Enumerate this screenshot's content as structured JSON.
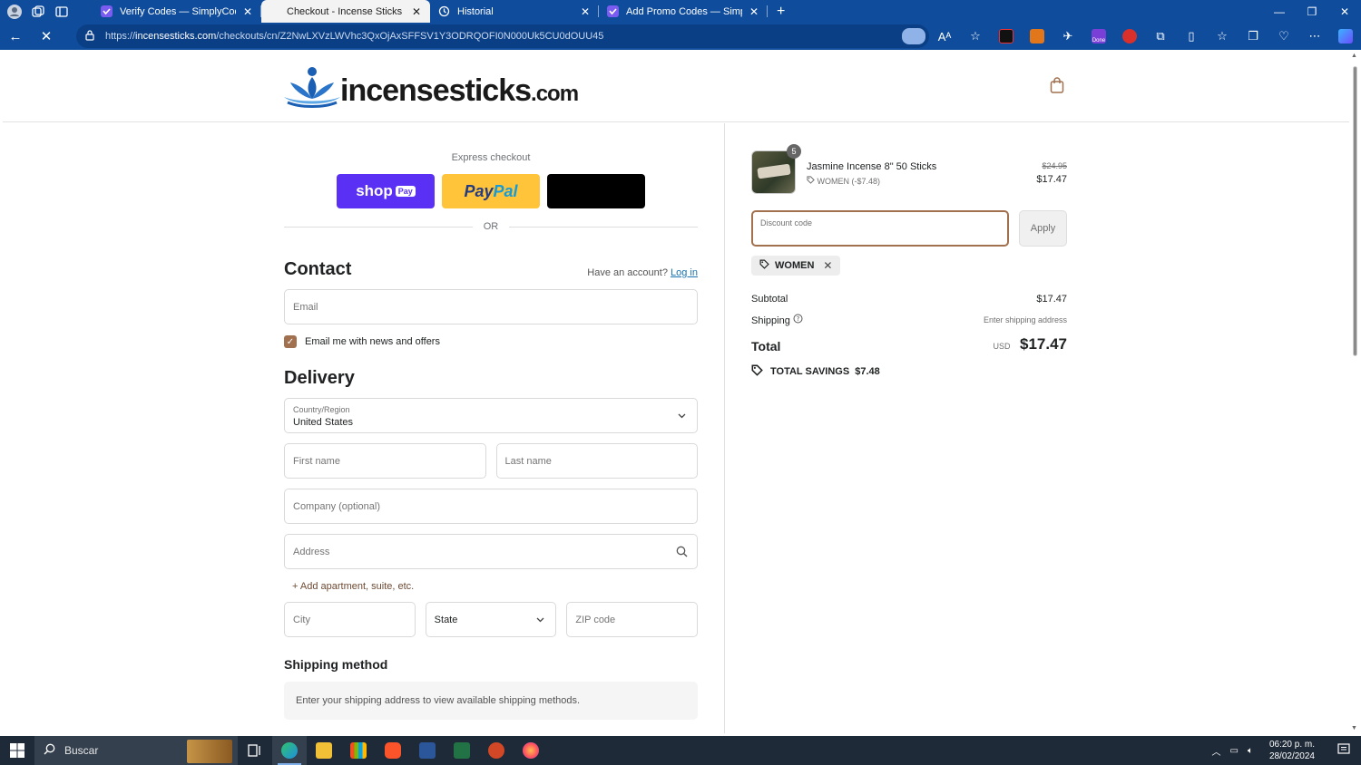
{
  "browser": {
    "tabs": [
      {
        "title": "Verify Codes — SimplyCodes",
        "active": false
      },
      {
        "title": "Checkout - Incense Sticks",
        "active": true
      },
      {
        "title": "Historial",
        "active": false
      },
      {
        "title": "Add Promo Codes — SimplyCod",
        "active": false
      }
    ],
    "url_domain": "incensesticks.com",
    "url_prefix": "https://",
    "url_path": "/checkouts/cn/Z2NwLXVzLWVhc3QxOjAxSFFSV1Y3ODRQOFI0N000Uk5CU0dOUU45",
    "ext_badge": "Done"
  },
  "header": {
    "logo_word": "incensesticks",
    "logo_tld": ".com"
  },
  "express": {
    "title": "Express checkout",
    "shoppay": "shop",
    "shoppay_tag": "Pay",
    "paypal_a": "Pay",
    "paypal_b": "Pal",
    "or": "OR"
  },
  "contact": {
    "heading": "Contact",
    "account_q": "Have an account?",
    "login": "Log in",
    "email_placeholder": "Email",
    "newsletter_label": "Email me with news and offers"
  },
  "delivery": {
    "heading": "Delivery",
    "country_label": "Country/Region",
    "country_value": "United States",
    "first_name": "First name",
    "last_name": "Last name",
    "company": "Company (optional)",
    "address": "Address",
    "add_apartment": "+ Add apartment, suite, etc.",
    "city": "City",
    "state": "State",
    "zip": "ZIP code"
  },
  "shipping_method": {
    "heading": "Shipping method",
    "info": "Enter your shipping address to view available shipping methods."
  },
  "summary": {
    "item": {
      "quantity": "5",
      "name": "Jasmine Incense 8\" 50 Sticks",
      "discount": "WOMEN (-$7.48)",
      "original_price": "$24.95",
      "price": "$17.47"
    },
    "discount_placeholder": "Discount code",
    "apply": "Apply",
    "applied_code": "WOMEN",
    "subtotal_label": "Subtotal",
    "subtotal_value": "$17.47",
    "shipping_label": "Shipping",
    "shipping_value": "Enter shipping address",
    "total_label": "Total",
    "currency": "USD",
    "total_value": "$17.47",
    "savings_label": "TOTAL SAVINGS",
    "savings_value": "$7.48"
  },
  "taskbar": {
    "search": "Buscar",
    "time": "06:20 p. m.",
    "date": "28/02/2024"
  },
  "colors": {
    "browser_chrome": "#0f4c9c",
    "accent_brown": "#a1704e",
    "shoppay": "#5a31f4",
    "paypal": "#ffc439",
    "taskbar": "#1f2a38"
  }
}
